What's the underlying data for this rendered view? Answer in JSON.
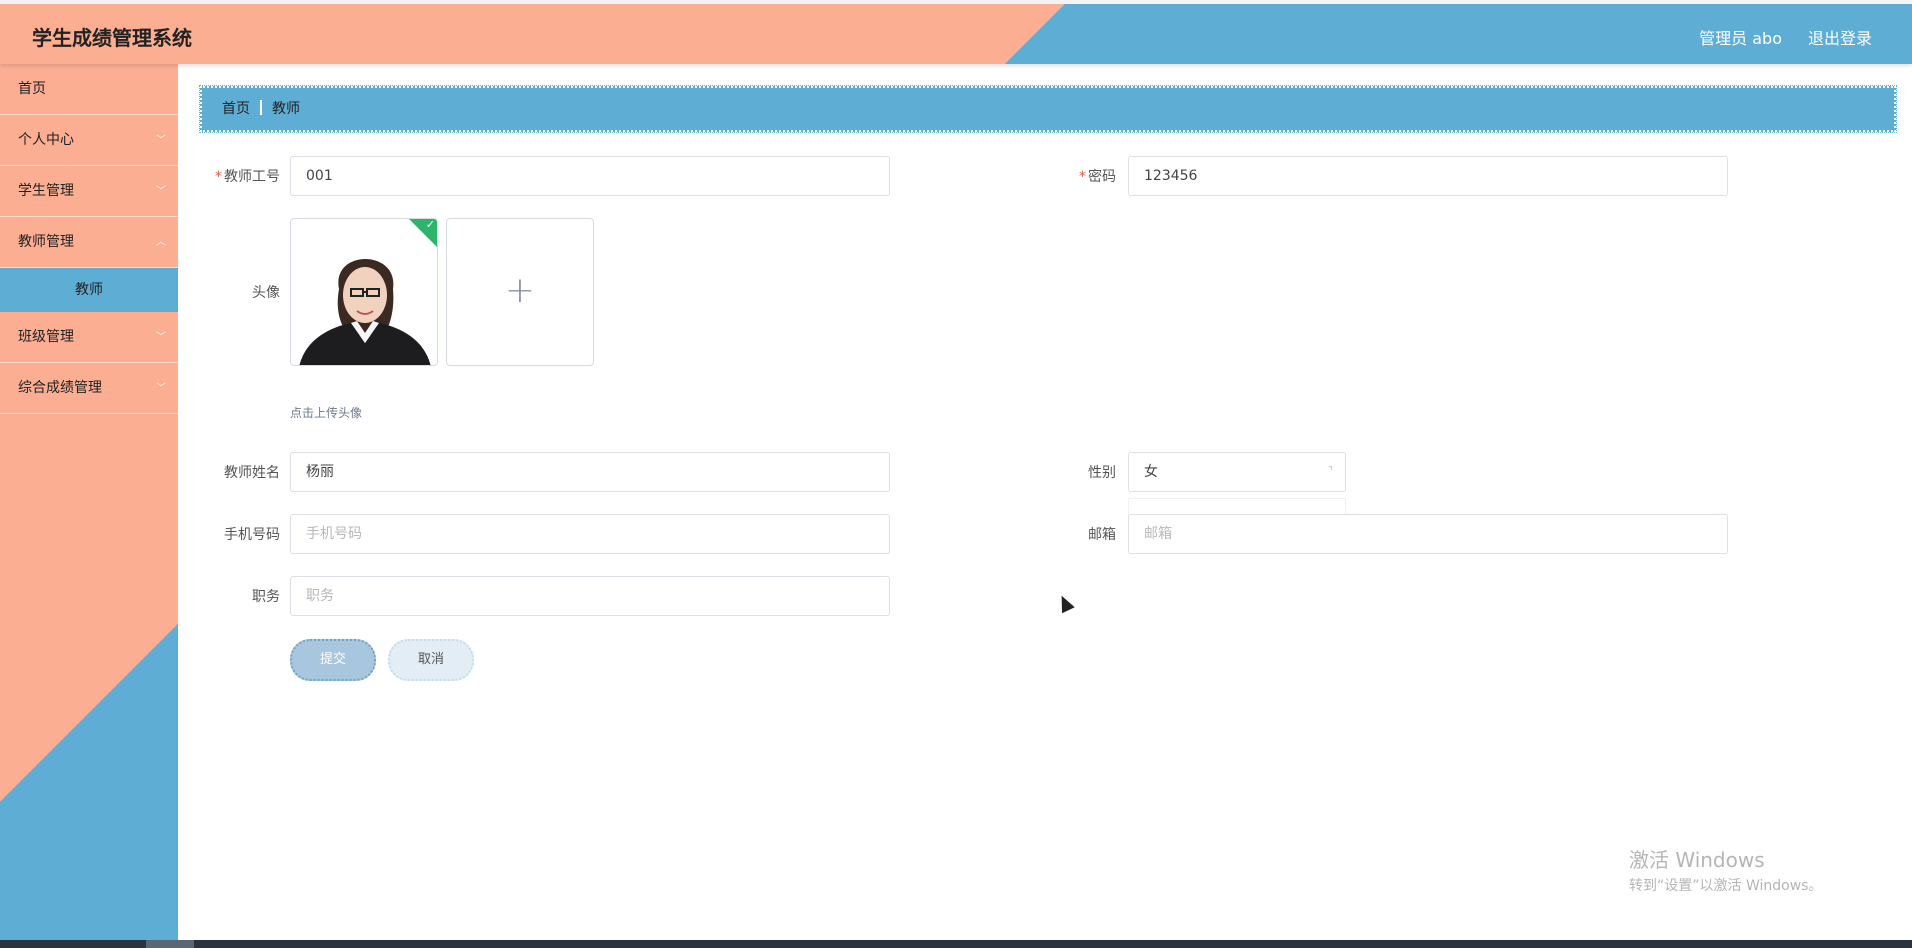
{
  "header": {
    "title": "学生成绩管理系统",
    "admin": "管理员 abo",
    "logout": "退出登录"
  },
  "sidebar": {
    "items": [
      {
        "label": "首页"
      },
      {
        "label": "个人中心"
      },
      {
        "label": "学生管理"
      },
      {
        "label": "教师管理"
      },
      {
        "label": "教师"
      },
      {
        "label": "班级管理"
      },
      {
        "label": "综合成绩管理"
      }
    ]
  },
  "breadcrumb": {
    "home": "首页",
    "current": "教师"
  },
  "form": {
    "teacher_id": {
      "label": "教师工号",
      "value": "001"
    },
    "password": {
      "label": "密码",
      "value": "123456"
    },
    "avatar": {
      "label": "头像",
      "tip": "点击上传头像",
      "add_icon": "+"
    },
    "name": {
      "label": "教师姓名",
      "value": "杨丽"
    },
    "gender": {
      "label": "性别",
      "value": "女"
    },
    "phone": {
      "label": "手机号码",
      "placeholder": "手机号码"
    },
    "email": {
      "label": "邮箱",
      "placeholder": "邮箱"
    },
    "position": {
      "label": "职务",
      "placeholder": "职务"
    },
    "submit": "提交",
    "cancel": "取消"
  },
  "watermark": {
    "line1": "激活 Windows",
    "line2": "转到“设置”以激活 Windows。"
  },
  "colors": {
    "accent_blue": "#5eadd4",
    "accent_peach": "#fbae92",
    "success_green": "#2eb56b",
    "required_red": "#e05a4c"
  }
}
